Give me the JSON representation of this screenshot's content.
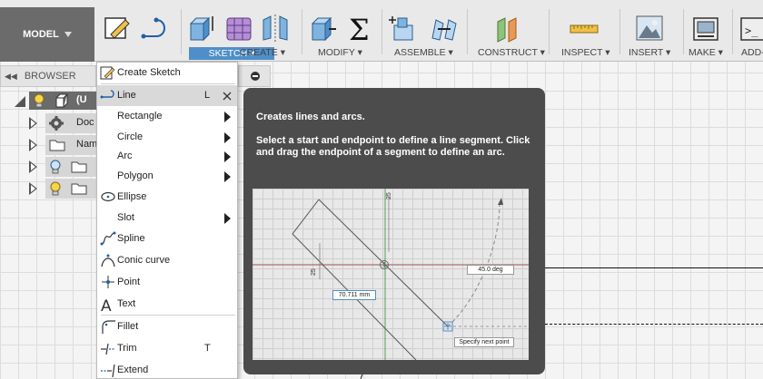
{
  "toolbar": {
    "workspace": "MODEL",
    "sketch": "SKETCH",
    "create": "CREATE",
    "modify": "MODIFY",
    "assemble": "ASSEMBLE",
    "construct": "CONSTRUCT",
    "inspect": "INSPECT",
    "insert": "INSERT",
    "make": "MAKE",
    "addins": "ADD-"
  },
  "browser": {
    "title": "BROWSER",
    "rows": [
      {
        "label": "(U"
      },
      {
        "label": "Doc"
      },
      {
        "label": "Nam"
      },
      {
        "label": ""
      },
      {
        "label": ""
      }
    ]
  },
  "sketch_menu": {
    "items": [
      {
        "label": "Create Sketch",
        "icon": "create-sketch-icon"
      },
      {
        "label": "Line",
        "shortcut": "L",
        "icon": "line-icon",
        "selected": true
      },
      {
        "label": "Rectangle",
        "submenu": true
      },
      {
        "label": "Circle",
        "submenu": true
      },
      {
        "label": "Arc",
        "submenu": true
      },
      {
        "label": "Polygon",
        "submenu": true
      },
      {
        "label": "Ellipse",
        "icon": "ellipse-icon"
      },
      {
        "label": "Slot",
        "submenu": true
      },
      {
        "label": "Spline",
        "icon": "spline-icon"
      },
      {
        "label": "Conic curve",
        "icon": "conic-curve-icon"
      },
      {
        "label": "Point",
        "icon": "point-icon"
      },
      {
        "label": "Text",
        "icon": "text-icon"
      },
      {
        "label": "Fillet",
        "icon": "fillet-icon"
      },
      {
        "label": "Trim",
        "shortcut": "T",
        "icon": "trim-icon"
      },
      {
        "label": "Extend",
        "icon": "extend-icon"
      }
    ]
  },
  "tooltip": {
    "title": "Creates lines and arcs.",
    "body": "Select a start and endpoint to define a line segment. Click and drag the endpoint of a segment to define an arc.",
    "image": {
      "dim_25_top": "25",
      "dim_25_left": "25",
      "length": "70.711 mm",
      "angle": "45.0 deg",
      "prompt": "Specify next point"
    }
  },
  "colors": {
    "accent": "#4f8fc9",
    "tooltip_bg": "#4c4c4c",
    "workspace_btn": "#6b6b6b"
  }
}
